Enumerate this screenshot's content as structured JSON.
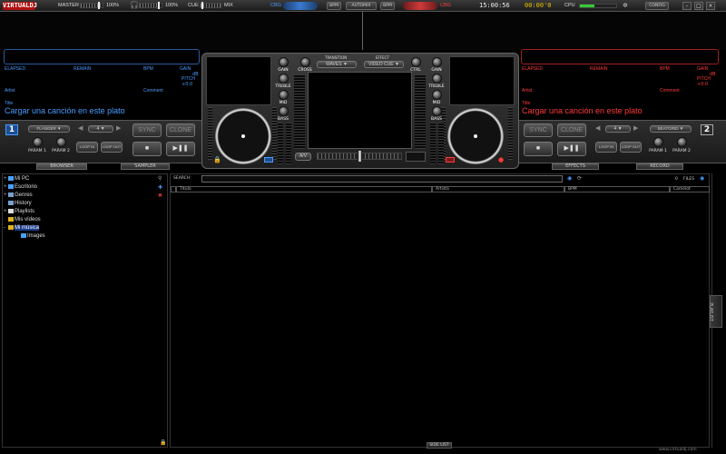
{
  "topbar": {
    "logo": "VIRTUALDJ",
    "master_label": "MASTER",
    "master_pct": "100%",
    "headphone_pct": "100%",
    "cue_label": "CUE",
    "mix_label": "MIX",
    "cbg_left": "CBG",
    "cbg_right": "CBG",
    "btn_bpm1": "BPM",
    "btn_automix": "AUTOMIX",
    "btn_bpm2": "BPM",
    "time": "15:00:56",
    "timer": "00:00'0",
    "cpu_label": "CPU",
    "config": "CONFIG",
    "minimize": "-",
    "maximize": "□",
    "close": "×"
  },
  "deck_left": {
    "elapsed": "ELAPSED",
    "remain": "REMAIN",
    "bpm": "BPM",
    "gain": "GAIN",
    "gain_val": "dB",
    "pitch": "PITCH",
    "pitch_val": "+0.0",
    "artist": "Artist",
    "comment": "Comment",
    "title": "Title",
    "load_text": "Cargar una canción en este plato",
    "number": "1",
    "effect_select": "FLANGER",
    "loop_select": "4",
    "sync": "SYNC",
    "clone": "CLONE",
    "param1": "PARAM 1",
    "param2": "PARAM 2",
    "loop_in": "LOOP IN",
    "loop_out": "LOOP OUT",
    "cue": "■",
    "play": "▶❚❚",
    "cue_btn_label": "CUE",
    "pitch_reset": "Pitch"
  },
  "deck_right": {
    "elapsed": "ELAPSED",
    "remain": "REMAIN",
    "bpm": "BPM",
    "gain": "GAIN",
    "gain_val": "dB",
    "pitch": "PITCH",
    "pitch_val": "+0.0",
    "artist": "Artist",
    "comment": "Comment",
    "title": "Title",
    "load_text": "Cargar una canción en este plato",
    "number": "2",
    "effect_select": "BEATGRID",
    "loop_select": "4",
    "sync": "SYNC",
    "clone": "CLONE",
    "param1": "PARAM 1",
    "param2": "PARAM 2",
    "loop_in": "LOOP IN",
    "loop_out": "LOOP OUT",
    "cue": "■",
    "play": "▶❚❚",
    "cue_btn_label": "CUE",
    "pitch_reset": "Pitch"
  },
  "mixer": {
    "gain": "GAIN",
    "treble": "TREBLE",
    "mid": "MID",
    "bass": "BASS",
    "cross": "CROSS",
    "ctrl": "CTRL",
    "transition_label": "TRANSITION",
    "transition_value": "WAVES",
    "effect_label": "EFFECT",
    "effect_value": "VIDEO CUE",
    "av": "A/V"
  },
  "tabs": {
    "browser": "BROWSER",
    "sampler": "SAMPLER",
    "effects": "EFFECTS",
    "record": "RECORD"
  },
  "tree": [
    {
      "label": "Mi PC",
      "expander": "+",
      "color": "#4aa0ff"
    },
    {
      "label": "Escritorio",
      "expander": "+",
      "color": "#4aa0ff"
    },
    {
      "label": "Genres",
      "expander": "+",
      "color": "#7aa0d0"
    },
    {
      "label": "History",
      "expander": "",
      "color": "#7aa0d0"
    },
    {
      "label": "Playlists",
      "expander": "+",
      "color": "#dddddd"
    },
    {
      "label": "Mis vídeos",
      "expander": "",
      "color": "#e0b020"
    },
    {
      "label": "Mi música",
      "expander": "-",
      "color": "#e0b020"
    },
    {
      "label": "Images",
      "expander": "",
      "color": "#4aa0ff"
    }
  ],
  "filelist": {
    "search_label": "SEARCH:",
    "search_value": "",
    "files_count": "0",
    "files_label": "FILES",
    "columns": [
      "Título",
      "Artista",
      "BPM",
      "Camelot"
    ],
    "side_list": "SIDE LIST",
    "playlist_tab": "PLAYLIST"
  },
  "footer": "www.virtualdj.com",
  "colors": {
    "left_accent": "#4a9cff",
    "right_accent": "#ff3a3a",
    "left_box": "#2a5aa0",
    "right_box": "#a02020"
  }
}
